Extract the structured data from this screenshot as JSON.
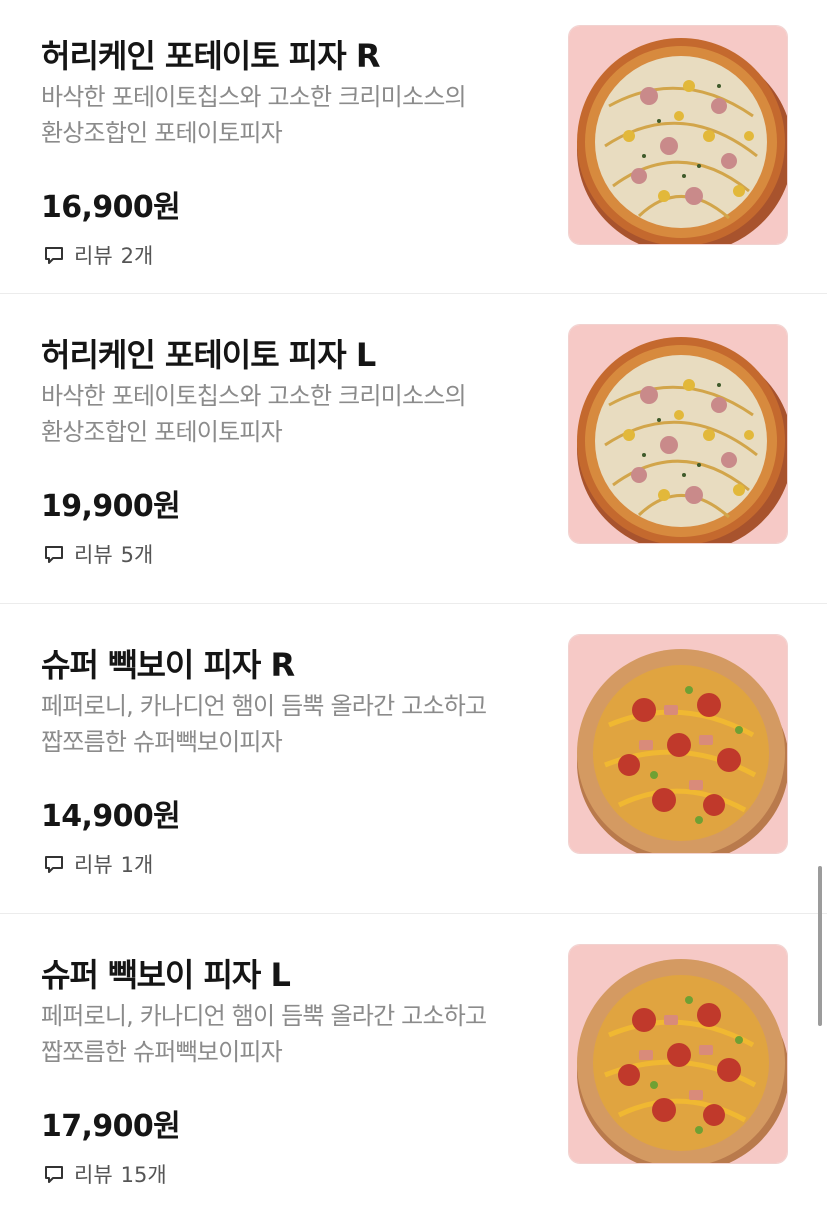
{
  "menu_items": [
    {
      "title": "허리케인 포테이토 피자 R",
      "description": "바삭한 포테이토칩스와 고소한 크리미소스의 환상조합인 포테이토피자",
      "price": "16,900원",
      "review_label": "리뷰",
      "review_count": "2개",
      "image": "potato-pizza-image"
    },
    {
      "title": "허리케인 포테이토 피자 L",
      "description": "바삭한 포테이토칩스와 고소한 크리미소스의 환상조합인 포테이토피자",
      "price": "19,900원",
      "review_label": "리뷰",
      "review_count": "5개",
      "image": "potato-pizza-image"
    },
    {
      "title": "슈퍼 빽보이 피자 R",
      "description": "페퍼로니, 카나디언 햄이 듬뿍 올라간 고소하고 짭쪼름한 슈퍼빽보이피자",
      "price": "14,900원",
      "review_label": "리뷰",
      "review_count": "1개",
      "image": "super-paik-boy-pizza-image"
    },
    {
      "title": "슈퍼 빽보이 피자 L",
      "description": "페퍼로니, 카나디언 햄이 듬뿍 올라간 고소하고 짭쪼름한 슈퍼빽보이피자",
      "price": "17,900원",
      "review_label": "리뷰",
      "review_count": "15개",
      "image": "super-paik-boy-pizza-image"
    }
  ],
  "icons": {
    "review": "speech-bubble-icon"
  },
  "colors": {
    "text_primary": "#151515",
    "text_secondary": "#8b8b8b",
    "thumb_background": "#f6c9c6",
    "divider": "#ececec"
  }
}
